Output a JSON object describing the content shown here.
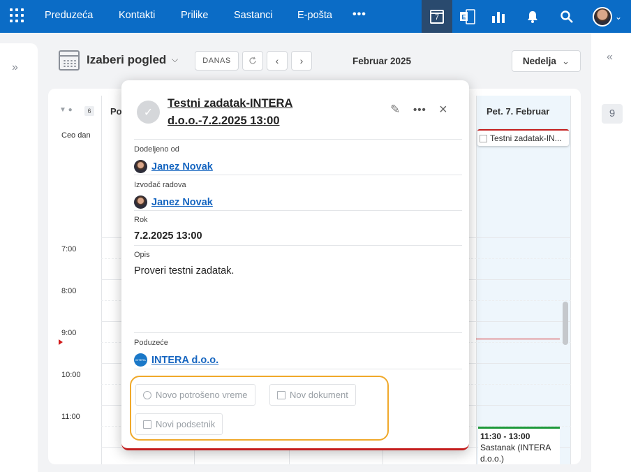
{
  "topbar": {
    "nav": [
      "Preduzeća",
      "Kontakti",
      "Prilike",
      "Sastanci",
      "E-pošta"
    ],
    "more": "•••",
    "calendar_day": "7"
  },
  "toolbar": {
    "view_title": "Izaberi pogled",
    "today_button": "DANAS",
    "period": "Februar 2025",
    "range_select": "Nedelja"
  },
  "right_panel": {
    "badge": "9"
  },
  "calendar": {
    "count_badge": "6",
    "first_col_header": "Po",
    "all_day_label": "Ceo dan",
    "friday_header": "Pet. 7. Februar",
    "times": [
      "7:00",
      "8:00",
      "9:00",
      "10:00",
      "11:00"
    ],
    "allday_event": "Testni zadatak-IN...",
    "meeting_time": "11:30 - 13:00",
    "meeting_text": " Sastanak (INTERA d.o.o.)"
  },
  "popup": {
    "title_line1": "Testni zadatak-INTERA",
    "title_line2": "d.o.o.-7.2.2025 13:00",
    "assigned_by_label": "Dodeljeno od",
    "assigned_by": "Janez Novak",
    "contractor_label": "Izvođač radova",
    "contractor": "Janez Novak",
    "deadline_label": "Rok",
    "deadline": "7.2.2025 13:00",
    "description_label": "Opis",
    "description": "Proveri testni zadatak.",
    "company_label": "Poduzeće",
    "company": "INTERA d.o.o.",
    "company_logo_text": "INTERA",
    "actions": {
      "time_spent": "Novo potrošeno vreme",
      "document": "Nov dokument",
      "reminder": "Novi podsetnik"
    }
  },
  "colors": {
    "topbar": "#0b6cc6",
    "link": "#1565c0",
    "task_accent": "#c41e1e",
    "meeting_accent": "#1e9a3c",
    "highlight": "#f0a92a"
  }
}
